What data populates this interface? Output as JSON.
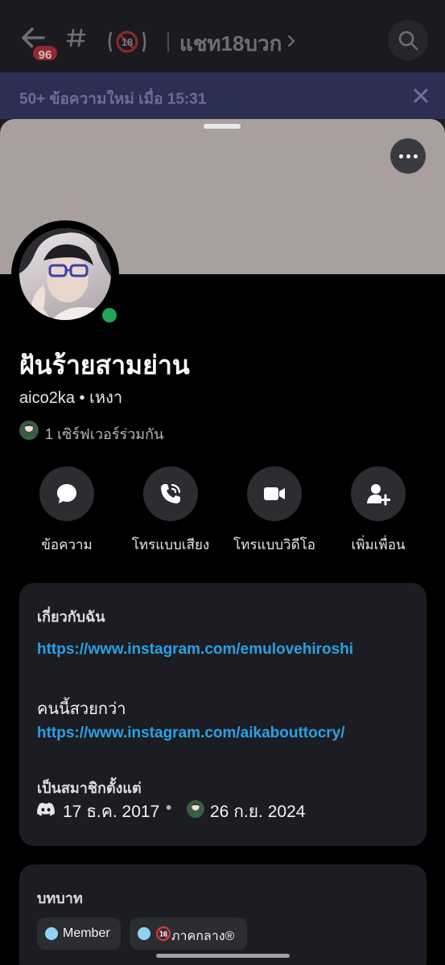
{
  "topbar": {
    "unread_badge": "96",
    "channel_name": "แชท18บวก",
    "icons": [
      "back-arrow-icon",
      "hashtag-icon",
      "age-restricted-icon",
      "chevron-right-icon",
      "search-icon"
    ]
  },
  "new_messages": {
    "text": "50+ ข้อความใหม่ เมื่อ 15:31",
    "close_icon": "close-icon"
  },
  "profile": {
    "display_name": "ฝันร้ายสามย่าน",
    "username_line": "aico2ka • เหงา",
    "mutual_servers": "1 เซิร์ฟเวอร์ร่วมกัน",
    "status_color": "#23a55a",
    "banner_color": "#a99f9e"
  },
  "actions": [
    {
      "label": "ข้อความ",
      "icon": "message-icon"
    },
    {
      "label": "โทรแบบเสียง",
      "icon": "phone-icon"
    },
    {
      "label": "โทรแบบวิดีโอ",
      "icon": "video-icon"
    },
    {
      "label": "เพิ่มเพื่อน",
      "icon": "add-friend-icon"
    }
  ],
  "about": {
    "heading": "เกี่ยวกับฉัน",
    "link1": "https://www.instagram.com/emulovehiroshi",
    "note": "คนนี้สวยกว่า",
    "link2": "https://www.instagram.com/aikabouttocry/",
    "member_since_heading": "เป็นสมาชิกตั้งแต่",
    "discord_since": "17 ธ.ค. 2017",
    "separator": "•",
    "server_since": "26 ก.ย. 2024"
  },
  "roles": {
    "heading": "บทบาท",
    "items": [
      {
        "name": "Member",
        "color": "#8fd3f4"
      },
      {
        "name": "ภาคกลาง®",
        "color": "#8fd3f4"
      }
    ]
  },
  "colors": {
    "accent_link": "#2aa0e6",
    "card_bg": "#1c1d22",
    "sheet_bg": "#000000"
  }
}
